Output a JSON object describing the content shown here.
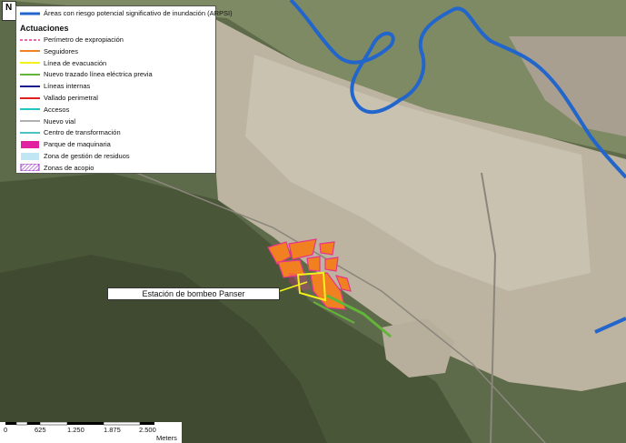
{
  "legend": {
    "arpsi": "Áreas con riesgo potencial significativo de inundación (ARPSI)",
    "title": "Actuaciones",
    "items": [
      {
        "label": "Perímetro de expropiación",
        "symbol": "dashed-line",
        "color": "#e8358a"
      },
      {
        "label": "Seguidores",
        "symbol": "line",
        "color": "#f08020"
      },
      {
        "label": "Línea de evacuación",
        "symbol": "line",
        "color": "#f2f21a"
      },
      {
        "label": "Nuevo trazado línea eléctrica previa",
        "symbol": "line",
        "color": "#62b53a"
      },
      {
        "label": "Líneas internas",
        "symbol": "line",
        "color": "#1a1a8c"
      },
      {
        "label": "Vallado perimetral",
        "symbol": "line",
        "color": "#e02020"
      },
      {
        "label": "Accesos",
        "symbol": "line",
        "color": "#22c4c4"
      },
      {
        "label": "Nuevo vial",
        "symbol": "line",
        "color": "#b0b0b0"
      },
      {
        "label": "Centro de transformación",
        "symbol": "line",
        "color": "#4cc4c4"
      },
      {
        "label": "Parque de maquinaria",
        "symbol": "fill",
        "color": "#e020a0"
      },
      {
        "label": "Zona de gestión de residuos",
        "symbol": "fill",
        "color": "#bfe6f2"
      },
      {
        "label": "Zonas de acopio",
        "symbol": "hatch",
        "color": "#9b30c8"
      }
    ],
    "arpsi_color": "#2266cc"
  },
  "annotation": "Estación de bombeo Panser",
  "north_arrow": "N",
  "scale_bar": {
    "ticks": [
      "0",
      "625",
      "1.250",
      "1.875",
      "2.500"
    ],
    "unit": "Meters"
  }
}
